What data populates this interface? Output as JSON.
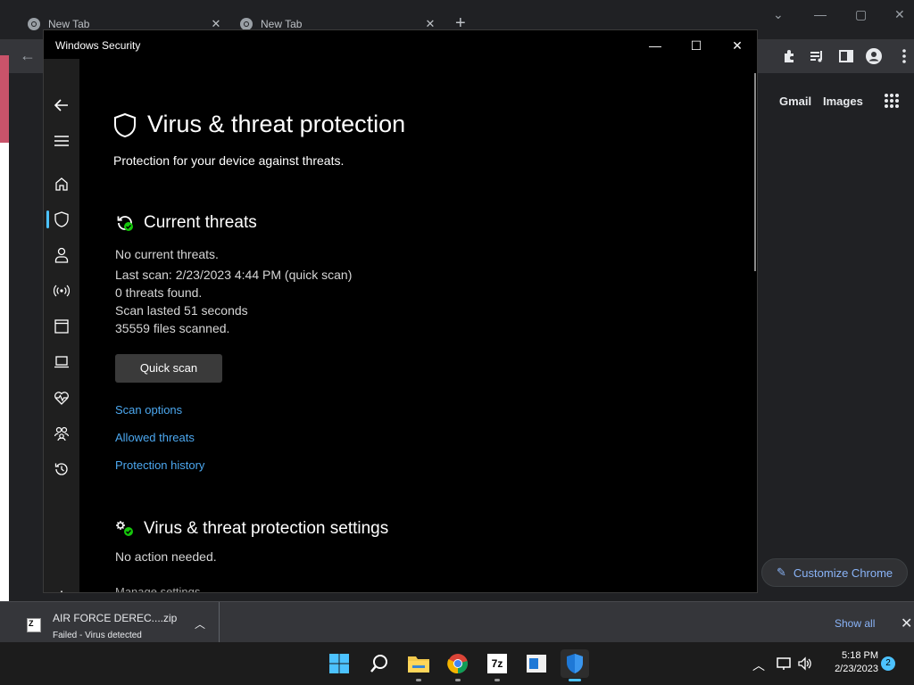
{
  "chrome": {
    "tabs": [
      {
        "title": "New Tab"
      },
      {
        "title": "New Tab"
      }
    ],
    "new_tab_glyph": "+",
    "header_links": {
      "gmail": "Gmail",
      "images": "Images"
    },
    "customize_label": "Customize Chrome",
    "toolbar_icons": [
      "extensions-icon",
      "media-icon",
      "side-panel-icon",
      "profile-icon",
      "menu-icon"
    ]
  },
  "download": {
    "file_name": "AIR FORCE DEREC....zip",
    "status": "Failed - Virus detected",
    "file_badge": "Z",
    "show_all": "Show all"
  },
  "security_window": {
    "title": "Windows Security",
    "page_title": "Virus & threat protection",
    "page_subtitle": "Protection for your device against threats.",
    "current_threats": {
      "heading": "Current threats",
      "status": "No current threats.",
      "last_scan": "Last scan: 2/23/2023 4:44 PM (quick scan)",
      "threats_found": "0 threats found.",
      "scan_duration": "Scan lasted 51 seconds",
      "files_scanned": "35559 files scanned.",
      "quick_scan_button": "Quick scan",
      "links": {
        "scan_options": "Scan options",
        "allowed_threats": "Allowed threats",
        "protection_history": "Protection history"
      }
    },
    "settings": {
      "heading": "Virus & threat protection settings",
      "status": "No action needed.",
      "manage_link": "Manage settings"
    },
    "nav_icons": [
      "back-icon",
      "hamburger-icon",
      "home-icon",
      "shield-icon",
      "account-icon",
      "firewall-icon",
      "app-browser-icon",
      "device-security-icon",
      "health-icon",
      "family-icon",
      "history-icon",
      "settings-icon"
    ],
    "accent_color": "#4cc2ff",
    "link_color": "#4ca8f0"
  },
  "taskbar": {
    "apps": [
      "start-icon",
      "search-icon",
      "file-explorer-icon",
      "chrome-icon",
      "7zip-icon",
      "app-icon",
      "windows-security-icon"
    ],
    "seven_zip_label": "7z",
    "time": "5:18 PM",
    "date": "2/23/2023",
    "notification_count": "2"
  }
}
